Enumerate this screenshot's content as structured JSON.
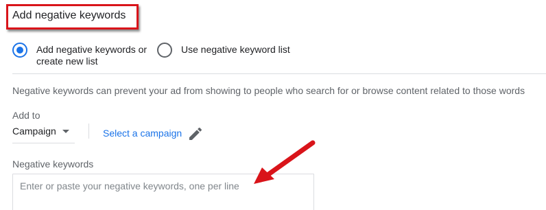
{
  "title": "Add negative keywords",
  "radio_options": [
    {
      "line1": "Add negative keywords or",
      "line2": "create new list",
      "selected": true
    },
    {
      "line1": "Use negative keyword list",
      "line2": "",
      "selected": false
    }
  ],
  "description": "Negative keywords can prevent your ad from showing to people who search for or browse content related to those words",
  "add_to": {
    "label": "Add to",
    "selected_value": "Campaign"
  },
  "select_campaign_link": "Select a campaign",
  "negative_keywords": {
    "label": "Negative keywords",
    "placeholder": "Enter or paste your negative keywords, one per line",
    "value": ""
  },
  "colors": {
    "accent": "#1a73e8",
    "annotation_red": "#d9141a"
  },
  "icons": {
    "dropdown": "caret-down-icon",
    "edit": "pencil-icon",
    "annotation": "red-arrow"
  }
}
